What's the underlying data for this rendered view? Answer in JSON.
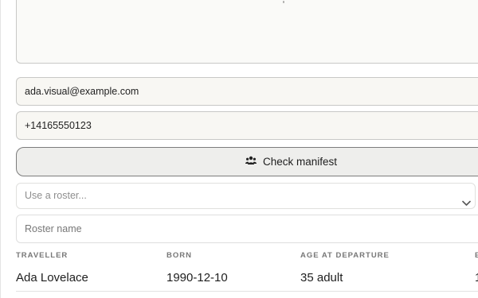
{
  "form": {
    "notes_value": "",
    "email_value": "ada.visual@example.com",
    "phone_value": "+14165550123",
    "check_button_label": "Check manifest",
    "roster_select_placeholder": "Use a roster...",
    "roster_name_placeholder": "Roster name"
  },
  "table": {
    "headers": [
      "TRAVELLER",
      "BORN",
      "AGE AT DEPARTURE",
      "E"
    ],
    "rows": [
      [
        "Ada Lovelace",
        "1990-12-10",
        "35 adult",
        "1"
      ]
    ]
  },
  "icons": {
    "button_icon": "people-group-icon",
    "select_icon": "chevron-down-icon"
  }
}
